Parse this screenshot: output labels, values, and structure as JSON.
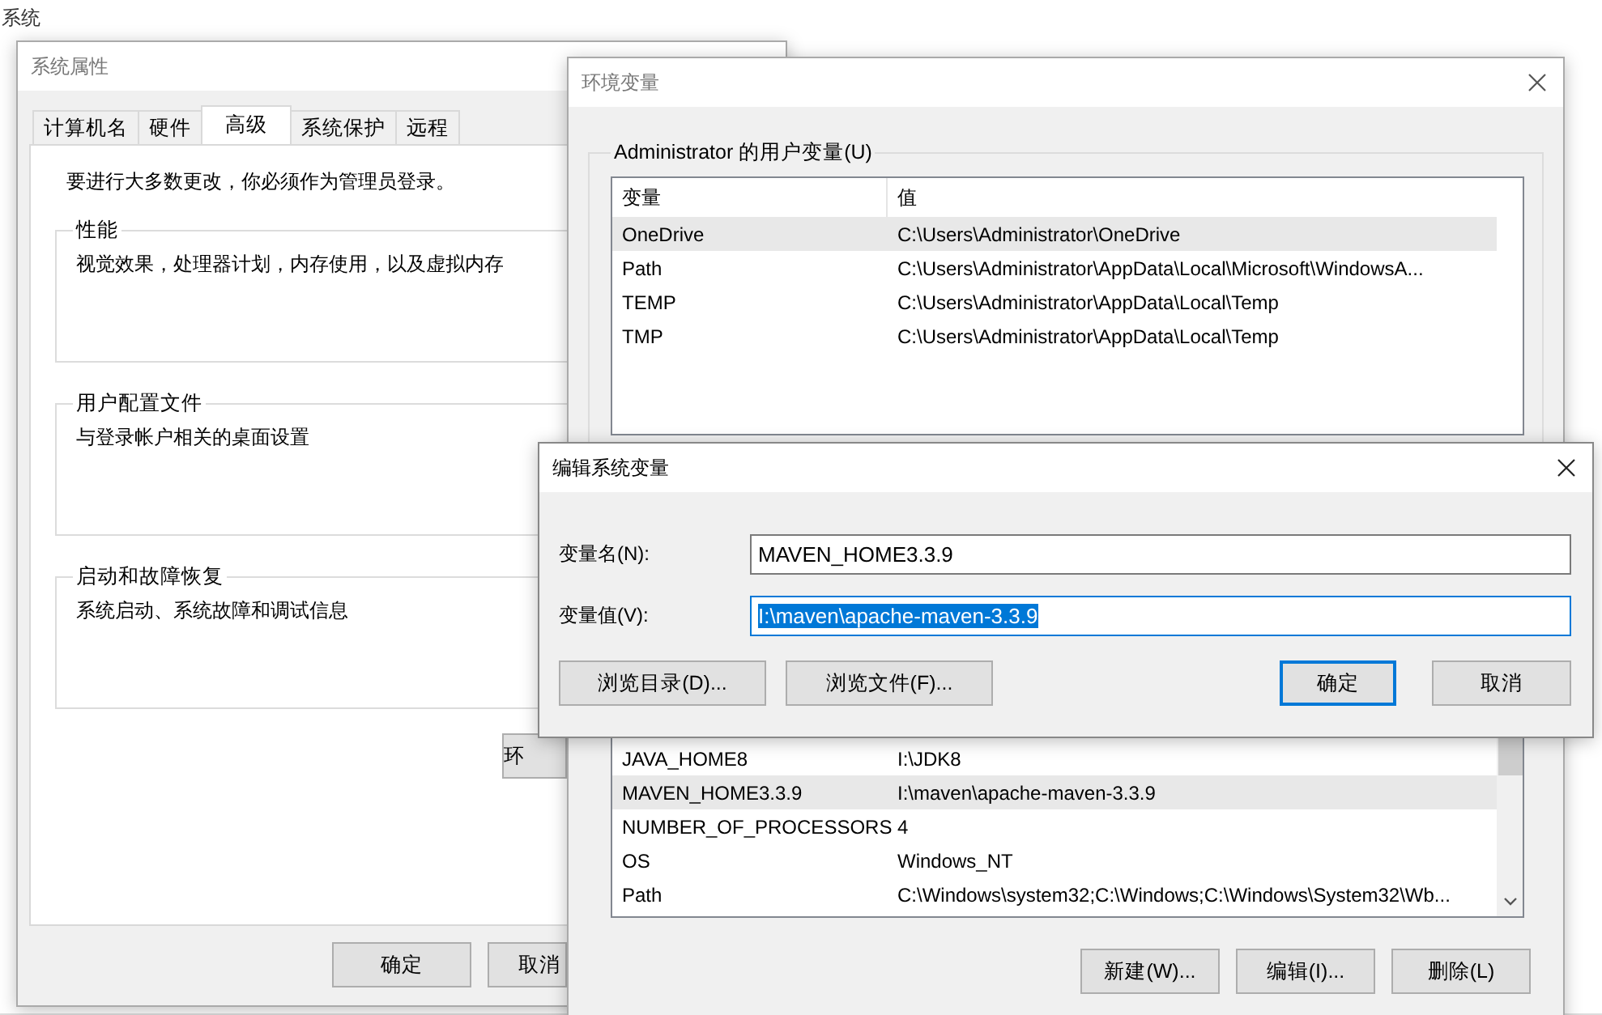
{
  "background_window": {
    "title": "系统"
  },
  "system_properties": {
    "title": "系统属性",
    "tabs": [
      {
        "label": "计算机名",
        "selected": false
      },
      {
        "label": "硬件",
        "selected": false
      },
      {
        "label": "高级",
        "selected": true
      },
      {
        "label": "系统保护",
        "selected": false
      },
      {
        "label": "远程",
        "selected": false
      }
    ],
    "notice": "要进行大多数更改，你必须作为管理员登录。",
    "groups": [
      {
        "title": "性能",
        "description": "视觉效果，处理器计划，内存使用，以及虚拟内存"
      },
      {
        "title": "用户配置文件",
        "description": "与登录帐户相关的桌面设置"
      },
      {
        "title": "启动和故障恢复",
        "description": "系统启动、系统故障和调试信息"
      }
    ],
    "env_button": "环",
    "buttons": [
      "确定",
      "取消"
    ]
  },
  "environment_variables": {
    "title": "环境变量",
    "user_group": {
      "title": "Administrator 的用户变量(U)",
      "columns": [
        "变量",
        "值"
      ],
      "rows": [
        {
          "name": "OneDrive",
          "value": "C:\\Users\\Administrator\\OneDrive",
          "selected": true
        },
        {
          "name": "Path",
          "value": "C:\\Users\\Administrator\\AppData\\Local\\Microsoft\\WindowsA...",
          "selected": false
        },
        {
          "name": "TEMP",
          "value": "C:\\Users\\Administrator\\AppData\\Local\\Temp",
          "selected": false
        },
        {
          "name": "TMP",
          "value": "C:\\Users\\Administrator\\AppData\\Local\\Temp",
          "selected": false
        }
      ]
    },
    "system_rows": [
      {
        "name": "JAVA_HOME8",
        "value": "I:\\JDK8",
        "selected": false
      },
      {
        "name": "MAVEN_HOME3.3.9",
        "value": "I:\\maven\\apache-maven-3.3.9",
        "selected": true
      },
      {
        "name": "NUMBER_OF_PROCESSORS",
        "value": "4",
        "selected": false
      },
      {
        "name": "OS",
        "value": "Windows_NT",
        "selected": false
      },
      {
        "name": "Path",
        "value": "C:\\Windows\\system32;C:\\Windows;C:\\Windows\\System32\\Wb...",
        "selected": false
      }
    ],
    "buttons": [
      "新建(W)...",
      "编辑(I)...",
      "删除(L)"
    ]
  },
  "edit_dialog": {
    "title": "编辑系统变量",
    "fields": [
      {
        "label": "变量名(N):",
        "value": "MAVEN_HOME3.3.9",
        "focused": false
      },
      {
        "label": "变量值(V):",
        "value": "I:\\maven\\apache-maven-3.3.9",
        "focused": true
      }
    ],
    "browse_buttons": [
      "浏览目录(D)...",
      "浏览文件(F)..."
    ],
    "buttons": [
      {
        "label": "确定",
        "default": true
      },
      {
        "label": "取消",
        "default": false
      }
    ]
  }
}
